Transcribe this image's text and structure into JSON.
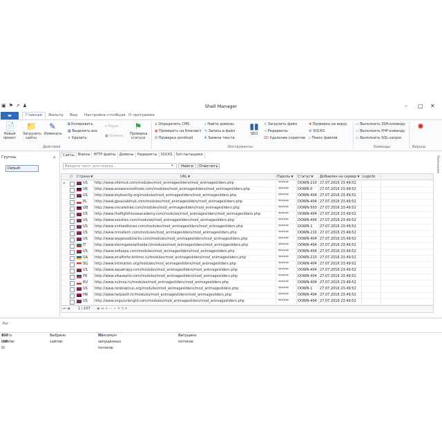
{
  "window": {
    "title": "Shell Manager",
    "controls": [
      "–",
      "□",
      "✕"
    ]
  },
  "ribbon_tabs": {
    "file": "",
    "tabs": [
      "Главная",
      "Фильтр",
      "Вид",
      "Настройка столбцов",
      "О программе"
    ],
    "active_index": 0
  },
  "ribbon": {
    "new_project": "Новый проект",
    "load_sites": "Загрузить сайты",
    "edit": "Изменить",
    "copy": "Копировать",
    "select_all": "Выделить все",
    "delete": "Удалить",
    "pause": "Пауза",
    "cancel": "Отмена",
    "status_check": "Проверка статуса",
    "actions_group": "Действия",
    "define_cms": "Определить CMS",
    "check_blacklist": "Проверить на блэклист",
    "check_sendmail": "Проверка sendmail",
    "find_domains": "Найти домены",
    "write_to_file": "Запись в файл",
    "change_text": "Замена текста",
    "seo": "SEO",
    "upload_file": "Загрузить файл",
    "redirects": "Редиректы",
    "delete_scripts": "Удаление скриптов",
    "check_virus": "Проверка на вирус",
    "socks": "SOCKS",
    "search_files": "Поиск файлов",
    "tools_group": "Инструменты",
    "exec_ssh": "Выполнить SSH-команду",
    "exec_php": "Выполнить PHP-команду",
    "exec_sql": "Выполнить SQL-запрос",
    "commands_group": "Команды",
    "viruses_group": "Вирусы"
  },
  "left_pane": {
    "header": "Группы",
    "selected_group": "Default"
  },
  "page_tabs": [
    "Сайты",
    "Файлы",
    "HTTP файлы",
    "Домены",
    "Редиректы",
    "SOCKS",
    "Ssh-пытыщики"
  ],
  "search": {
    "placeholder": "Введите текст для поиска ...",
    "find_label": "Найти",
    "clear_label": "Очистить"
  },
  "grid": {
    "columns": [
      "Страна",
      "URL",
      "Пароль",
      "Статус",
      "Добавлен на сервер",
      "Loginfo"
    ],
    "rows": [
      {
        "country": "US",
        "url": "http://www.sitemcd.com/modules/mod_animagesliders/mod_animagesliders.php",
        "password": "******",
        "status": "DOWN-210",
        "date": "27.07.2016 23:49:52"
      },
      {
        "country": "UK",
        "url": "http://www.answersmethode.com/modules/mod_animagesliders/mod_animagesliders.php",
        "password": "******",
        "status": "DOWN-0",
        "date": "27.07.2016 23:49:52"
      },
      {
        "country": "US",
        "url": "http://www.skyboxclig.org/modules/mod_animagesliders/mod_animagesliders.php",
        "password": "******",
        "status": "DOWN-404",
        "date": "27.07.2016 23:49:52"
      },
      {
        "country": "PL",
        "url": "http://www.gpsavalehub.com/modules/mod_animagesliders/mod_animagesliders.php",
        "password": "******",
        "status": "DOWN-404",
        "date": "27.07.2016 23:49:52"
      },
      {
        "country": "GB",
        "url": "http://www.viscatetrae.com/modules/mod_animagesliders/mod_animagesliders.php",
        "password": "******",
        "status": "DOWN-503",
        "date": "27.07.2016 23:49:52"
      },
      {
        "country": "US",
        "url": "http://www.theflighthouseacademy.com/modules/mod_animagesliders/mod_animagesliders.php",
        "password": "******",
        "status": "DOWN-404",
        "date": "27.07.2016 23:49:52"
      },
      {
        "country": "US",
        "url": "http://www.soosites.com/modules/mod_animagesliders/mod_animagesliders.php",
        "password": "******",
        "status": "DOWN-404",
        "date": "27.07.2016 23:49:52"
      },
      {
        "country": "US",
        "url": "http://www.sinfoeditorax.com/modules/mod_animagesliders/mod_animagesliders.php",
        "password": "******",
        "status": "DOWN-1",
        "date": "27.07.2016 23:49:52"
      },
      {
        "country": "US",
        "url": "http://www.mmatech.com/modules/mod_animagesliders/mod_animagesliders.php",
        "password": "******",
        "status": "DOWN-210",
        "date": "27.07.2016 23:49:52"
      },
      {
        "country": "US",
        "url": "http://www.wagwoodstacks.com/modules/mod_animagesliders/mod_animagesliders.php",
        "password": "******",
        "status": "DOWN-404",
        "date": "27.07.2016 23:49:52"
      },
      {
        "country": "IT",
        "url": "http://www.stormgatedathelda.it/modules/mod_animagesliders/mod_animagesliders.php",
        "password": "******",
        "status": "DOWN-404",
        "date": "27.07.2016 23:49:52"
      },
      {
        "country": "US",
        "url": "http://www.sofiaspa.com/modules/mod_animagesliders/mod_animagesliders.php",
        "password": "******",
        "status": "DOWN-404",
        "date": "27.07.2016 23:49:52"
      },
      {
        "country": "UA",
        "url": "http://www.strafforte-brikmo.ru/modules/mod_animagesliders/mod_animagesliders.php",
        "password": "******",
        "status": "DOWN-210",
        "date": "27.07.2016 23:49:52"
      },
      {
        "country": "SG",
        "url": "http://www.intimation.org/modules/mod_animagesliders/mod_animagesliders.php",
        "password": "******",
        "status": "DOWN-404",
        "date": "27.07.2016 23:49:52"
      },
      {
        "country": "US",
        "url": "http://www.aquatrapy.com/modules/mod_animagesliders/mod_animagesliders.php",
        "password": "******",
        "status": "DOWN-404",
        "date": "27.07.2016 23:49:52"
      },
      {
        "country": "FR",
        "url": "http://www.sikaseptio.com/modules/mod_animagesliders/mod_animagesliders.php",
        "password": "******",
        "status": "DOWN-404",
        "date": "27.07.2016 23:49:52"
      },
      {
        "country": "RU",
        "url": "http://www.sulmsa.ru/modules/mod_animagesliders/mod_animagesliders.php",
        "password": "******",
        "status": "DOWN-404",
        "date": "27.07.2016 23:49:52"
      },
      {
        "country": "US",
        "url": "http://www.nirobiaticus.org/modules/mod_animagesliders/mod_animagesliders.php",
        "password": "******",
        "status": "DOWN-1",
        "date": "27.07.2016 23:49:52"
      },
      {
        "country": "HR",
        "url": "http://www.herpasih.hr/modules/mod_animagesliders/mod_animagesliders.php",
        "password": "******",
        "status": "DOWN-404",
        "date": "27.07.2016 23:49:52"
      },
      {
        "country": "US",
        "url": "http://www.sngu/unbright.com/modules/mod_animagesliders/mod_animagesliders.php",
        "password": "******",
        "status": "DOWN-404",
        "date": "27.07.2016 23:49:52"
      },
      {
        "country": "US",
        "url": "http://www.slimgum/unbehere.com/modules/mod_animagesliders/mod_animagesliders.php",
        "password": "******",
        "status": "DOWN-404",
        "date": "27.07.2016 23:49:52"
      }
    ],
    "pager": "1 / 107"
  },
  "bottom": {
    "label": "Лог"
  },
  "statusbar": {
    "total_label": "Всего сайтов:",
    "total_value": "107 (OK: 0)",
    "selected_label": "Выбрано сайтов:",
    "selected_value": "0",
    "max_threads_label": "Максимум запущенных потоков:",
    "max_threads_value": "20",
    "running_label": "Запущено потоков:",
    "running_value": "0"
  },
  "side_strip": "Пояснения"
}
